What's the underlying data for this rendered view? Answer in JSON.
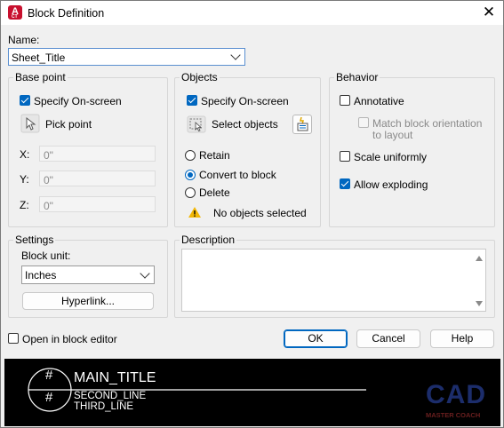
{
  "window": {
    "title": "Block Definition",
    "app_icon_letter": "A",
    "app_icon_sub": "CT"
  },
  "name": {
    "label": "Name:",
    "value": "Sheet_Title"
  },
  "base_point": {
    "title": "Base point",
    "specify_onscreen": "Specify On-screen",
    "pick_point": "Pick point",
    "x_label": "X:",
    "x_value": "0\"",
    "y_label": "Y:",
    "y_value": "0\"",
    "z_label": "Z:",
    "z_value": "0\""
  },
  "objects": {
    "title": "Objects",
    "specify_onscreen": "Specify On-screen",
    "select_objects": "Select objects",
    "retain": "Retain",
    "convert": "Convert to block",
    "delete": "Delete",
    "status": "No objects selected"
  },
  "behavior": {
    "title": "Behavior",
    "annotative": "Annotative",
    "match_orientation_1": "Match block orientation",
    "match_orientation_2": "to layout",
    "scale_uniformly": "Scale uniformly",
    "allow_exploding": "Allow exploding"
  },
  "settings": {
    "title": "Settings",
    "block_unit_label": "Block unit:",
    "block_unit_value": "Inches",
    "hyperlink": "Hyperlink..."
  },
  "description": {
    "title": "Description",
    "value": ""
  },
  "footer": {
    "open_in_editor": "Open in block editor",
    "ok": "OK",
    "cancel": "Cancel",
    "help": "Help"
  },
  "preview": {
    "hash_top": "#",
    "hash_bottom": "#",
    "main_title": "MAIN_TITLE",
    "second_line": "SECOND_LINE",
    "third_line": "THIRD_LINE",
    "watermark_text": "CAD",
    "watermark_sub": "MASTER COACH"
  },
  "colors": {
    "accent": "#0067c0",
    "warning": "#f2b705",
    "preview_bg": "#000000",
    "app_icon": "#c8102e"
  }
}
